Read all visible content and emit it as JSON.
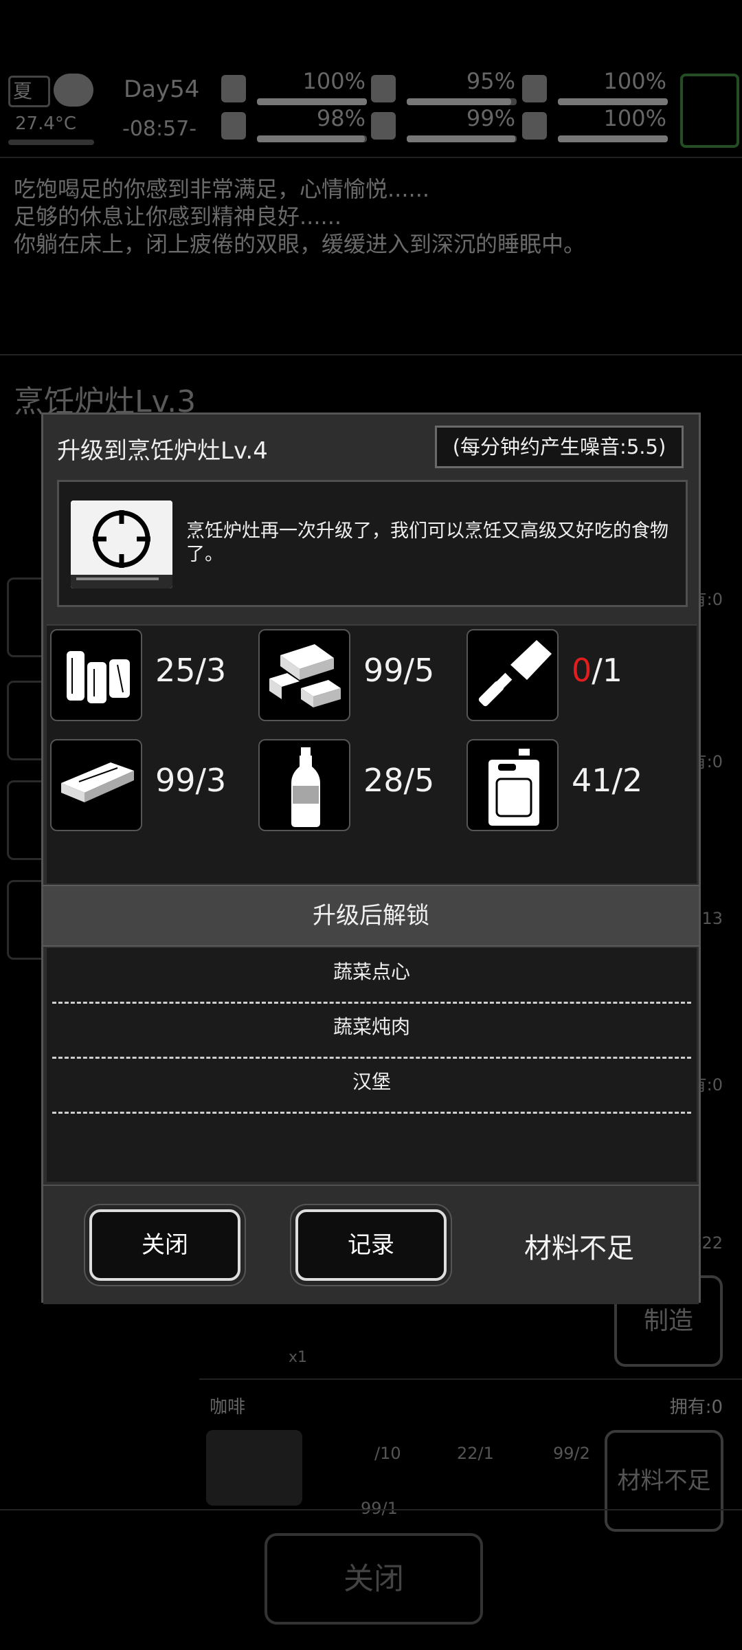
{
  "hud": {
    "season": "夏",
    "temperature": "27.4°C",
    "day": "Day54",
    "time": "-08:57-",
    "stats": [
      {
        "icon": "medkit-icon",
        "value": "100%",
        "level": 1.0
      },
      {
        "icon": "stomach-icon",
        "value": "95%",
        "level": 0.95
      },
      {
        "icon": "bladder-icon",
        "value": "100%",
        "level": 1.0
      },
      {
        "icon": "boot-icon",
        "value": "98%",
        "level": 0.98
      },
      {
        "icon": "water-drop-icon",
        "value": "99%",
        "level": 0.99
      },
      {
        "icon": "heart-icon",
        "value": "100%",
        "level": 1.0
      }
    ]
  },
  "log": [
    "吃饱喝足的你感到非常满足，心情愉悦......",
    "足够的休息让你感到精神良好......",
    "你躺在床上，闭上疲倦的双眼，缓缓进入到深沉的睡眠中。"
  ],
  "background": {
    "station_title": "烹饪炉灶Lv.3",
    "owned": [
      "有:0",
      "有:0",
      "13",
      "有:0",
      "22"
    ],
    "craft_label": "制造",
    "insufficient_label": "材料不足",
    "coffee": {
      "name": "咖啡",
      "owned": "拥有:0",
      "reqs": [
        "/10",
        "22/1",
        "99/2",
        "99/1"
      ],
      "button": "材料不足"
    },
    "bottom_close": "关闭",
    "stack_count": "x1"
  },
  "dialog": {
    "title": "升级到烹饪炉灶Lv.4",
    "noise": "(每分钟约产生噪音:5.5)",
    "description": "烹饪炉灶再一次升级了，我们可以烹饪又高级又好吃的食物了。",
    "materials": [
      {
        "icon": "wood-logs-icon",
        "have": "25",
        "need": "/3",
        "short": false
      },
      {
        "icon": "planks-icon",
        "have": "99",
        "need": "/5",
        "short": false
      },
      {
        "icon": "cleaver-icon",
        "have": "0",
        "need": "/1",
        "short": true
      },
      {
        "icon": "metal-plate-icon",
        "have": "99",
        "need": "/3",
        "short": false
      },
      {
        "icon": "bottle-icon",
        "have": "28",
        "need": "/5",
        "short": false
      },
      {
        "icon": "jerrycan-icon",
        "have": "41",
        "need": "/2",
        "short": false
      }
    ],
    "unlock_header": "升级后解锁",
    "unlocks": [
      "蔬菜点心",
      "蔬菜炖肉",
      "汉堡"
    ],
    "buttons": {
      "close": "关闭",
      "record": "记录",
      "insufficient": "材料不足"
    }
  },
  "colors": {
    "shortage": "#e31d1d",
    "panel": "#2e2e2e",
    "inner_panel": "#1b1b1b"
  }
}
